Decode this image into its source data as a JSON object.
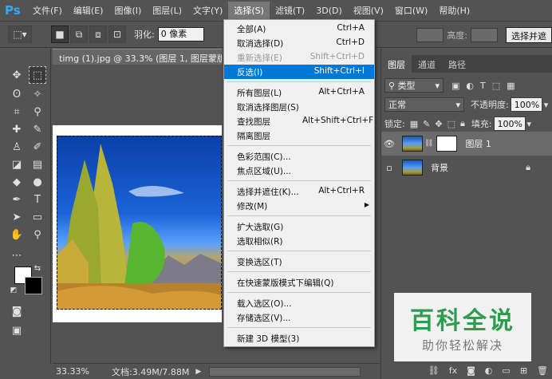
{
  "app": {
    "logo": "Ps"
  },
  "menubar": {
    "items": [
      "文件(F)",
      "编辑(E)",
      "图像(I)",
      "图层(L)",
      "文字(Y)",
      "选择(S)",
      "滤镜(T)",
      "3D(D)",
      "视图(V)",
      "窗口(W)",
      "帮助(H)"
    ],
    "active_index": 5
  },
  "options": {
    "feather_label": "羽化:",
    "feather_value": "0 像素",
    "height_label": "高度:",
    "select_mask": "选择并遮"
  },
  "document": {
    "tab_title": "timg (1).jpg @ 33.3% (图层 1, 图层蒙版/8)",
    "zoom": "33.33%",
    "doc_info": "文档:3.49M/7.88M"
  },
  "select_menu": {
    "items": [
      {
        "label": "全部(A)",
        "shortcut": "Ctrl+A"
      },
      {
        "label": "取消选择(D)",
        "shortcut": "Ctrl+D"
      },
      {
        "label": "重新选择(E)",
        "shortcut": "Shift+Ctrl+D",
        "disabled": true
      },
      {
        "label": "反选(I)",
        "shortcut": "Shift+Ctrl+I",
        "highlighted": true
      },
      {
        "label": "所有图层(L)",
        "shortcut": "Alt+Ctrl+A"
      },
      {
        "label": "取消选择图层(S)",
        "shortcut": ""
      },
      {
        "label": "查找图层",
        "shortcut": "Alt+Shift+Ctrl+F"
      },
      {
        "label": "隔离图层",
        "shortcut": ""
      },
      {
        "label": "色彩范围(C)...",
        "shortcut": ""
      },
      {
        "label": "焦点区域(U)...",
        "shortcut": ""
      },
      {
        "label": "选择并遮住(K)...",
        "shortcut": "Alt+Ctrl+R"
      },
      {
        "label": "修改(M)",
        "shortcut": "",
        "submenu": true
      },
      {
        "label": "扩大选取(G)",
        "shortcut": ""
      },
      {
        "label": "选取相似(R)",
        "shortcut": ""
      },
      {
        "label": "变换选区(T)",
        "shortcut": ""
      },
      {
        "label": "在快速蒙版模式下编辑(Q)",
        "shortcut": ""
      },
      {
        "label": "载入选区(O)...",
        "shortcut": ""
      },
      {
        "label": "存储选区(V)...",
        "shortcut": ""
      },
      {
        "label": "新建 3D 模型(3)",
        "shortcut": ""
      }
    ]
  },
  "layers_panel": {
    "tabs": [
      "图层",
      "通道",
      "路径"
    ],
    "active_tab": 0,
    "filter": "类型",
    "blend_mode": "正常",
    "opacity_label": "不透明度:",
    "opacity_value": "100%",
    "lock_label": "锁定:",
    "fill_label": "填充:",
    "fill_value": "100%",
    "layers": [
      {
        "name": "图层 1",
        "selected": true,
        "visible": true,
        "has_mask": true
      },
      {
        "name": "背景",
        "selected": false,
        "visible": false,
        "locked": true
      }
    ]
  },
  "watermark": {
    "title": "百科全说",
    "subtitle": "助你轻松解决"
  }
}
